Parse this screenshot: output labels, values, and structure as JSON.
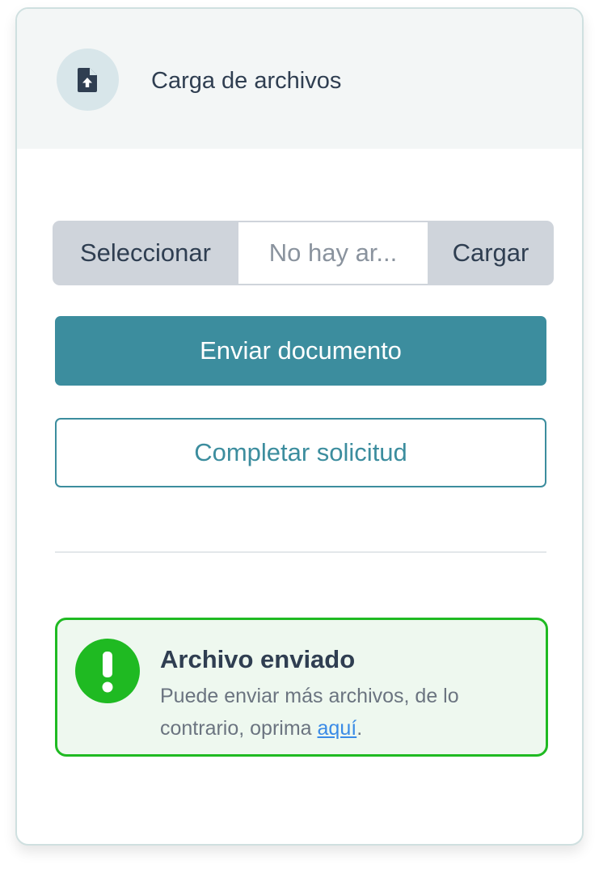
{
  "header": {
    "icon": "file-upload-icon",
    "title": "Carga de archivos"
  },
  "file_input": {
    "select_label": "Seleccionar",
    "file_name_value": "No hay ar...",
    "upload_label": "Cargar"
  },
  "actions": {
    "primary_label": "Enviar documento",
    "secondary_label": "Completar solicitud"
  },
  "alert": {
    "icon": "exclamation-icon",
    "title": "Archivo enviado",
    "body_text": "Puede enviar más archivos, de lo contrario, oprima ",
    "link_text": "aquí",
    "body_end": "."
  },
  "colors": {
    "accent": "#3c8d9e",
    "success": "#1fba22",
    "text_dark": "#2f3e51",
    "link": "#3a8be6"
  }
}
